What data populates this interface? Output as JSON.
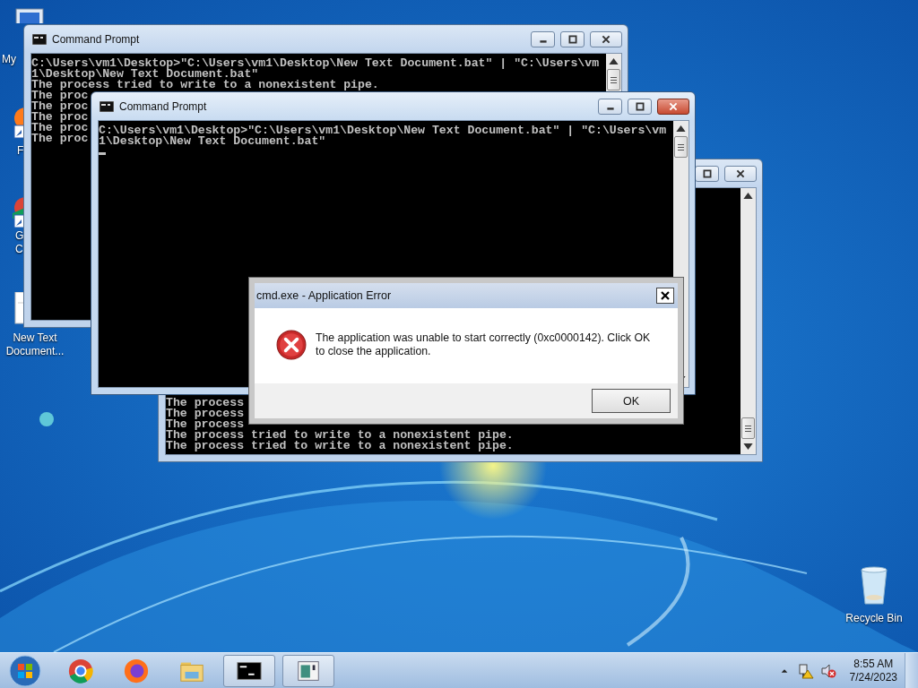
{
  "desktop_icons": [
    {
      "kind": "computer",
      "lines": [
        "My"
      ]
    },
    {
      "kind": "firefox",
      "lines": [
        "F"
      ]
    },
    {
      "kind": "chrome",
      "lines": [
        "G",
        "C"
      ]
    },
    {
      "kind": "textfile",
      "lines": [
        "New Text",
        "Document..."
      ]
    },
    {
      "kind": "recycle",
      "lines": [
        "Recycle Bin"
      ]
    }
  ],
  "windows": [
    {
      "title": "Command Prompt",
      "active": false,
      "controls": [
        {
          "kind": "minimize"
        },
        {
          "kind": "restore"
        },
        {
          "kind": "close"
        }
      ],
      "lines": [
        "C:\\Users\\vm1\\Desktop>\"C:\\Users\\vm1\\Desktop\\New Text Document.bat\" | \"C:\\Users\\vm",
        "1\\Desktop\\New Text Document.bat\"",
        "The process tried to write to a nonexistent pipe.",
        "The proc",
        "The proc",
        "The proc",
        "The proc",
        "The proc"
      ]
    },
    {
      "title": "Command Prompt",
      "active": true,
      "cursor": true,
      "controls": [
        {
          "kind": "minimize"
        },
        {
          "kind": "restore"
        },
        {
          "kind": "close"
        }
      ],
      "lines": [
        "C:\\Users\\vm1\\Desktop>\"C:\\Users\\vm1\\Desktop\\New Text Document.bat\" | \"C:\\Users\\vm",
        "1\\Desktop\\New Text Document.bat\""
      ]
    },
    {
      "active": false,
      "controls": [
        {
          "kind": "restore"
        },
        {
          "kind": "close"
        }
      ],
      "lines": [
        "The process",
        "The process",
        "The process",
        "The process tried to write to a nonexistent pipe.",
        "The process tried to write to a nonexistent pipe."
      ]
    }
  ],
  "dialog": {
    "title": "cmd.exe - Application Error",
    "message": "The application was unable to start correctly (0xc0000142). Click OK to close the application.",
    "button": "OK"
  },
  "taskbar": {
    "items": [
      {
        "kind": "chrome",
        "running": false
      },
      {
        "kind": "firefox",
        "running": false
      },
      {
        "kind": "explorer",
        "running": false
      },
      {
        "kind": "cmd",
        "running": true
      },
      {
        "kind": "app",
        "running": true
      }
    ],
    "clock": {
      "time": "8:55 AM",
      "date": "7/24/2023"
    }
  }
}
